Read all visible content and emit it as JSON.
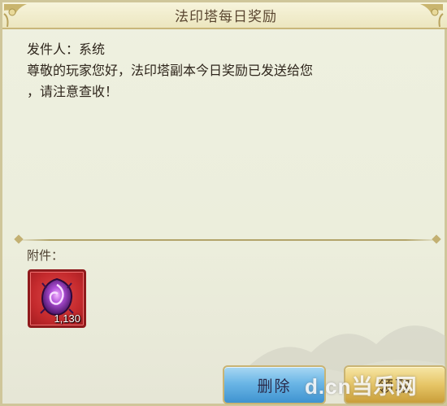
{
  "window": {
    "title": "法印塔每日奖励"
  },
  "mail": {
    "sender": "发件人：系统",
    "body_line1": "尊敬的玩家您好，法印塔副本今日奖励已发送给您",
    "body_line2": "，请注意查收！"
  },
  "attachments": {
    "label": "附件：",
    "items": [
      {
        "icon": "purple-gem-icon",
        "quantity": "1,130"
      }
    ]
  },
  "buttons": {
    "delete": "删除",
    "claim": "领取"
  },
  "watermark": "d.cn当乐网",
  "colors": {
    "title_text": "#5a4630",
    "body_text": "#2f261c",
    "slot_red": "#c42a2d",
    "delete_blue": "#6bb6e6",
    "claim_gold": "#e6c566"
  }
}
